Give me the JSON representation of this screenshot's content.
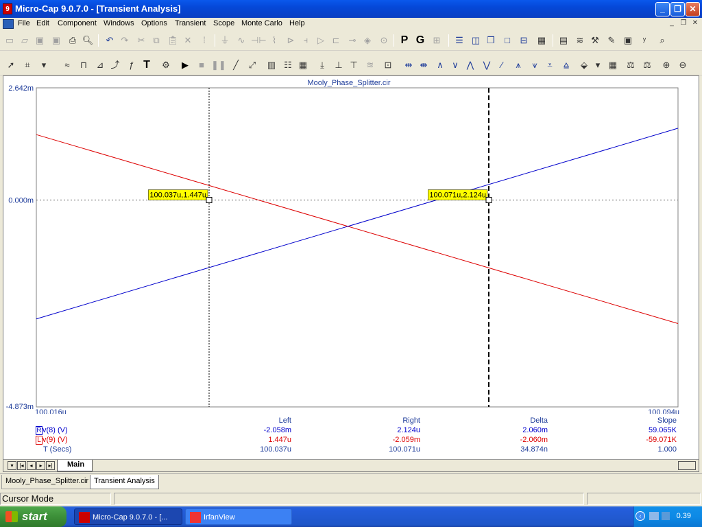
{
  "window": {
    "title": "Micro-Cap 9.0.7.0 - [Transient Analysis]",
    "app_icon": "microcap-icon",
    "controls": [
      "minimize",
      "restore",
      "close"
    ]
  },
  "menu": [
    "File",
    "Edit",
    "Component",
    "Windows",
    "Options",
    "Transient",
    "Scope",
    "Monte Carlo",
    "Help"
  ],
  "toolbar1": {
    "letter_p": "P",
    "letter_g": "G",
    "icons": [
      "new-icon",
      "open-icon",
      "save-icon",
      "save-as-icon",
      "print-icon",
      "print-preview-icon",
      "undo-icon",
      "redo-icon",
      "cut-icon",
      "copy-icon",
      "paste-icon",
      "delete-icon",
      "select-all-icon",
      "ground-icon",
      "resistor-icon",
      "capacitor-icon",
      "inductor-icon",
      "diode-icon",
      "battery-icon",
      "opamp-icon",
      "transistor-icon",
      "pin-icon",
      "probe-icon",
      "tile-horizontal-icon",
      "tile-vertical-icon",
      "cascade-icon",
      "window-icon",
      "split-icon",
      "calculator-icon",
      "component-list-icon",
      "waveform-icon",
      "help-icon",
      "probe-tool-icon",
      "graph-icon",
      "xy-icon",
      "find-icon"
    ]
  },
  "plot": {
    "circuit_title": "Mooly_Phase_Splitter.cir",
    "y_max_label": "2.642m",
    "y_zero_label": "0.000m",
    "y_min_label": "-4.873m",
    "x_min_label": "100.016u",
    "x_max_label": "100.094u",
    "grid_color": "#000000",
    "colors": {
      "v8": "#0000CC",
      "v9": "#DD0000"
    },
    "cursor_left_label": "100.037u,1.447u",
    "cursor_right_label": "100.071u,2.124u",
    "cursor_label_bg": "#FFFF00"
  },
  "chart_data": {
    "type": "line",
    "title": "Mooly_Phase_Splitter.cir",
    "xlim": [
      100.016,
      100.094
    ],
    "ylim": [
      -4.873,
      2.642
    ],
    "x_units": "u",
    "y_units": "m",
    "series": [
      {
        "name": "v(8) (V)",
        "x": [
          100.016,
          100.094
        ],
        "y": [
          -2.8,
          1.69
        ]
      },
      {
        "name": "v(9) (V)",
        "x": [
          100.016,
          100.094
        ],
        "y": [
          1.54,
          -2.91
        ]
      }
    ],
    "cursors": {
      "left_x": 100.037,
      "right_x": 100.071
    },
    "grid": "zero-line"
  },
  "readout": {
    "headers": {
      "left": "Left",
      "right": "Right",
      "delta": "Delta",
      "slope": "Slope"
    },
    "rows": [
      {
        "marker": "R",
        "name": "v(8) (V)",
        "left": "-2.058m",
        "right": "2.124u",
        "delta": "2.060m",
        "slope": "59.065K",
        "color": "#0000CC"
      },
      {
        "marker": "L",
        "name": "v(9) (V)",
        "left": "1.447u",
        "right": "-2.059m",
        "delta": "-2.060m",
        "slope": "-59.071K",
        "color": "#DD0000"
      },
      {
        "marker": "",
        "name": "T (Secs)",
        "left": "100.037u",
        "right": "100.071u",
        "delta": "34.874n",
        "slope": "1.000",
        "color": "#0000CC"
      }
    ]
  },
  "plot_tabs": {
    "active": "Main"
  },
  "doc_tabs": [
    "Mooly_Phase_Splitter.cir",
    "Transient Analysis"
  ],
  "status": {
    "mode": "Cursor Mode"
  },
  "taskbar": {
    "start": "start",
    "tasks": [
      "Micro-Cap 9.0.7.0 - [...",
      "IrfanView"
    ],
    "clock": "0.39"
  }
}
